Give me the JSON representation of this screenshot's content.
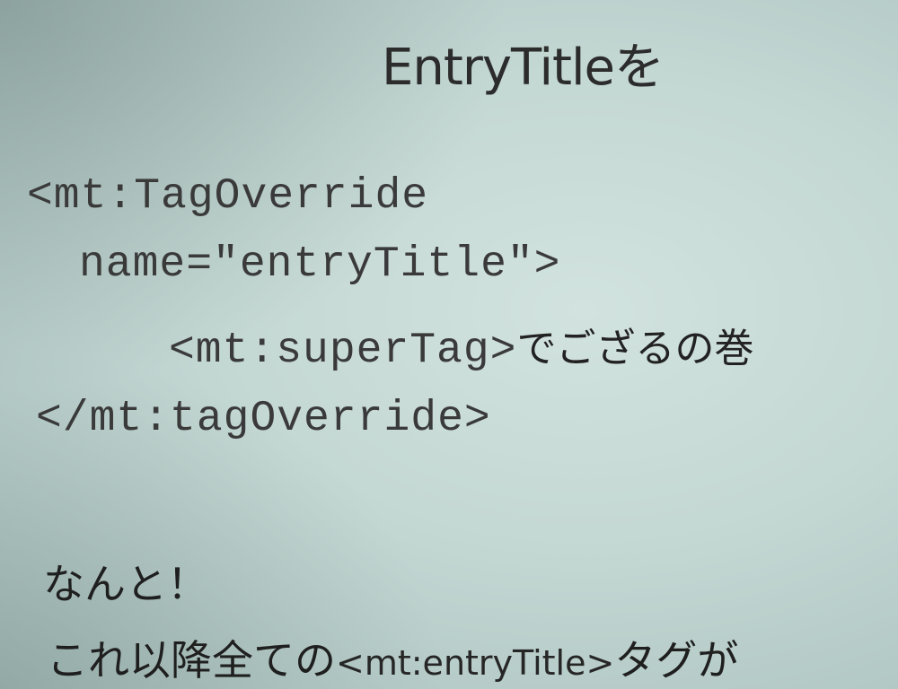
{
  "slide": {
    "title": "EntryTitleを",
    "code": {
      "line1": "<mt:TagOverride",
      "line2": "name=\"entryTitle\">",
      "line3_code": "<mt:superTag>",
      "line3_jp": "でござるの巻",
      "line4": "</mt:tagOverride>"
    },
    "notes": {
      "line1": "なんと！",
      "line2_before": "これ以降全ての",
      "line2_tag": "<mt:entryTitle>",
      "line2_after": "タグが"
    }
  }
}
